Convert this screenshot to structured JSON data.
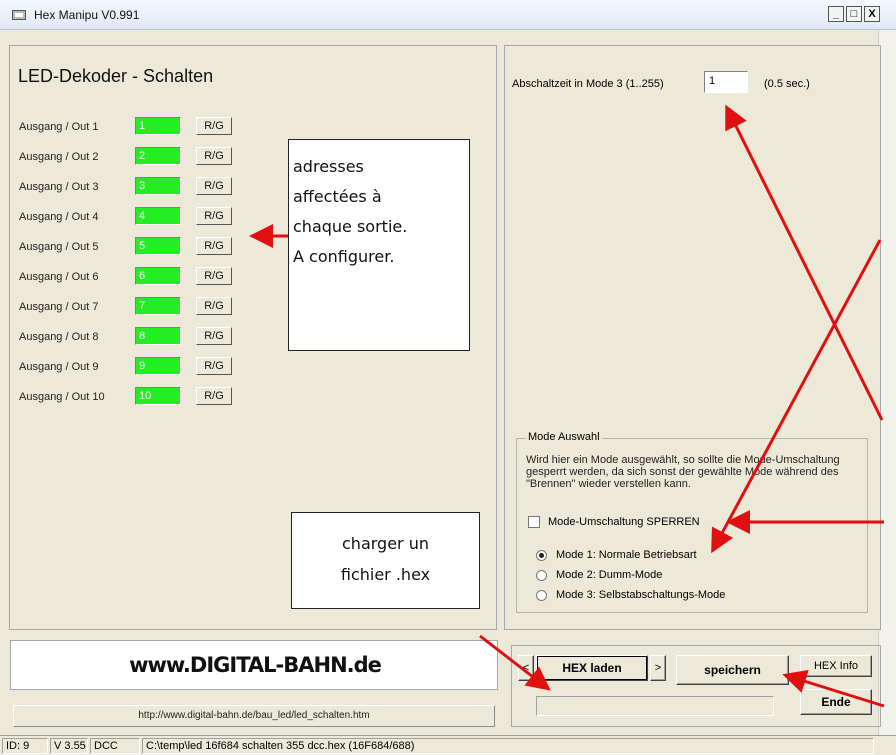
{
  "window": {
    "title": "Hex Manipu V0.991",
    "buttons": {
      "minimize": "_",
      "maximize": "□",
      "close": "X"
    }
  },
  "left_panel": {
    "heading": "LED-Dekoder - Schalten",
    "outputs": [
      {
        "label": "Ausgang / Out 1",
        "value": "1",
        "button": "R/G"
      },
      {
        "label": "Ausgang / Out 2",
        "value": "2",
        "button": "R/G"
      },
      {
        "label": "Ausgang / Out 3",
        "value": "3",
        "button": "R/G"
      },
      {
        "label": "Ausgang / Out 4",
        "value": "4",
        "button": "R/G"
      },
      {
        "label": "Ausgang / Out 5",
        "value": "5",
        "button": "R/G"
      },
      {
        "label": "Ausgang / Out 6",
        "value": "6",
        "button": "R/G"
      },
      {
        "label": "Ausgang / Out 7",
        "value": "7",
        "button": "R/G"
      },
      {
        "label": "Ausgang / Out 8",
        "value": "8",
        "button": "R/G"
      },
      {
        "label": "Ausgang / Out 9",
        "value": "9",
        "button": "R/G"
      },
      {
        "label": "Ausgang / Out 10",
        "value": "10",
        "button": "R/G"
      }
    ]
  },
  "annotations": {
    "addresses_note": [
      "adresses",
      "affectées à",
      "chaque sortie.",
      "A configurer."
    ],
    "hex_note": [
      "charger un",
      "fichier .hex"
    ],
    "arrow_color": "#e01010"
  },
  "right_panel": {
    "abschaltzeit_label": "Abschaltzeit in Mode 3 (1..255)",
    "abschaltzeit_value": "1",
    "abschaltzeit_unit": "(0.5 sec.)",
    "mode_group": {
      "legend": "Mode Auswahl",
      "description": "Wird hier ein Mode ausgewählt, so sollte die Mode-Umschaltung gesperrt werden, da  sich sonst der gewählte Mode während des \"Brennen\" wieder verstellen kann.",
      "lock_checkbox_label": "Mode-Umschaltung SPERREN",
      "lock_checked": false,
      "modes": [
        {
          "label": "Mode 1: Normale Betriebsart",
          "selected": true
        },
        {
          "label": "Mode 2: Dumm-Mode",
          "selected": false
        },
        {
          "label": "Mode 3: Selbstabschaltungs-Mode",
          "selected": false
        }
      ]
    }
  },
  "bottom": {
    "logo_text": "www.DIGITAL-BAHN.de",
    "url": "http://www.digital-bahn.de/bau_led/led_schalten.htm",
    "prev_label": "<",
    "hex_laden_label": "HEX laden",
    "next_label": ">",
    "speichern_label": "speichern",
    "hex_info_label": "HEX Info",
    "ende_label": "Ende"
  },
  "statusbar": {
    "id": "ID: 9",
    "version": "V 3.55",
    "mode": "DCC",
    "file": "C:\\temp\\led 16f684 schalten 355 dcc.hex (16F684/688)"
  },
  "colors": {
    "field_green": "#22ee22",
    "window_bg": "#ece9d8"
  }
}
